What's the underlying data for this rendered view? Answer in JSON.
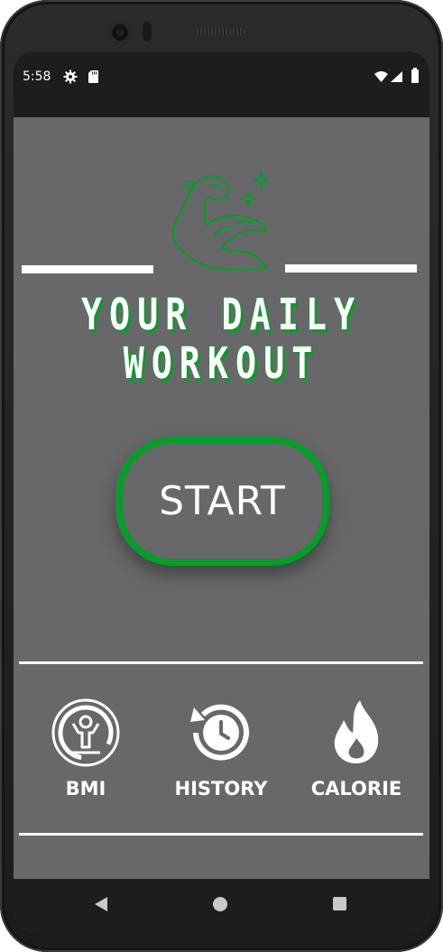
{
  "status_bar": {
    "time": "5:58",
    "icons": [
      "settings-gear-icon",
      "sd-card-icon",
      "wifi-icon",
      "cell-signal-icon",
      "battery-icon"
    ]
  },
  "hero": {
    "icon": "flexed-arm-icon",
    "title_line1": "YOUR DAILY",
    "title_line2": "WORKOUT"
  },
  "start_button": {
    "label": "START"
  },
  "bottom_menu": {
    "items": [
      {
        "label": "BMI",
        "icon": "bmi-person-icon"
      },
      {
        "label": "HISTORY",
        "icon": "history-clock-icon"
      },
      {
        "label": "CALORIE",
        "icon": "flame-icon"
      }
    ]
  },
  "nav_bar": {
    "icons": [
      "back-triangle-icon",
      "home-circle-icon",
      "recents-square-icon"
    ]
  },
  "colors": {
    "background": "#68686a",
    "accent_green": "#0b9a2c",
    "text": "#ffffff",
    "system_bar": "#1d1d1d"
  }
}
